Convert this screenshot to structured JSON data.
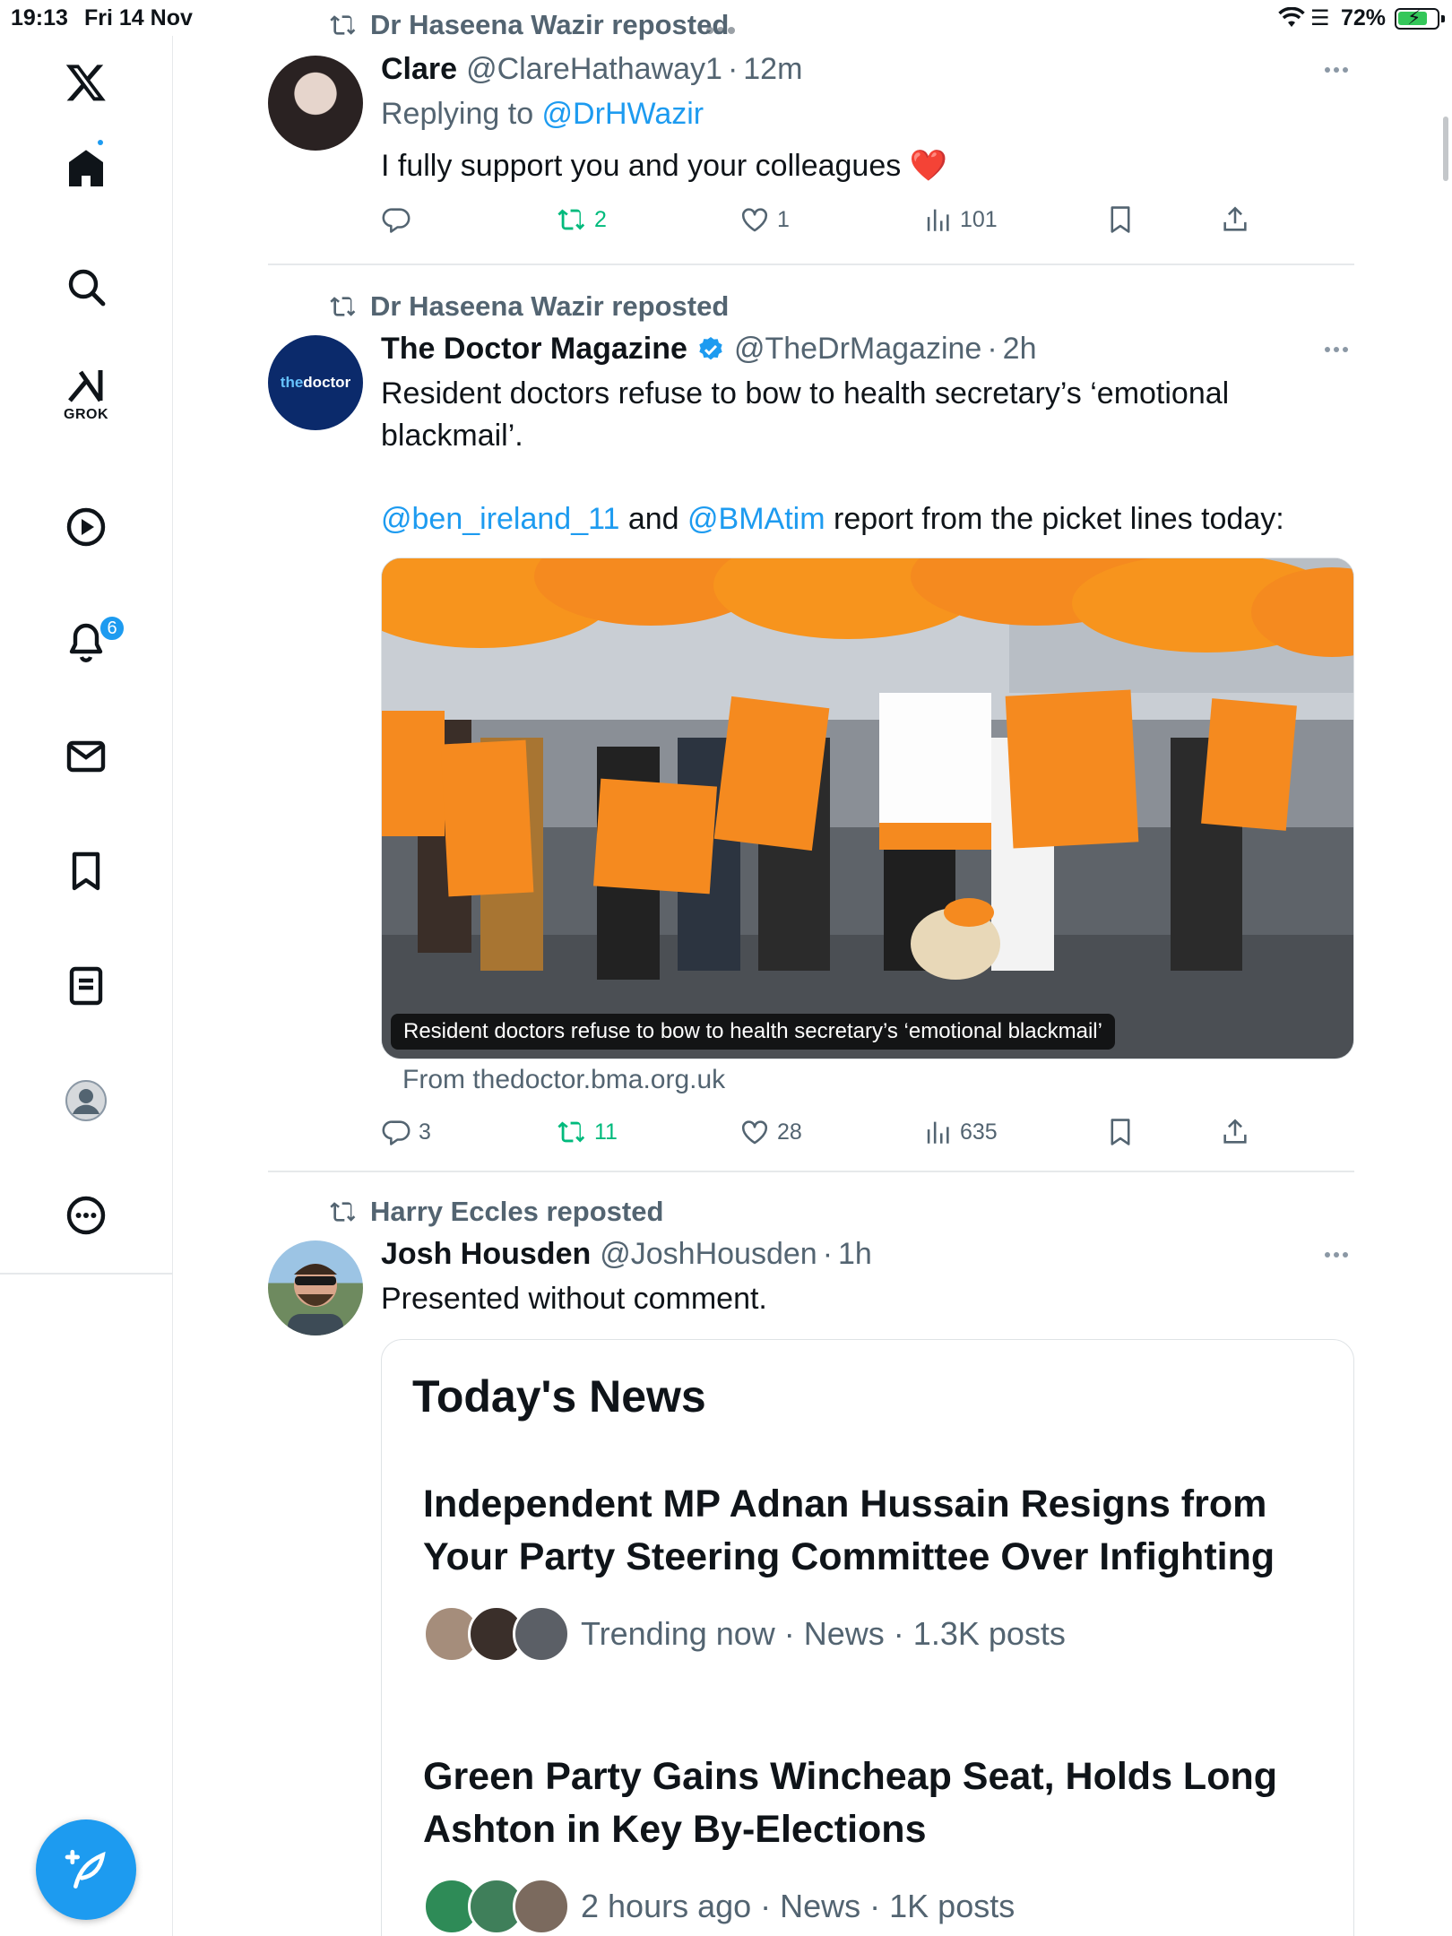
{
  "status_bar": {
    "time": "19:13",
    "date": "Fri 14 Nov",
    "battery": "72%"
  },
  "sidebar": {
    "items": [
      {
        "icon": "x-logo-icon"
      },
      {
        "icon": "home-icon"
      },
      {
        "icon": "search-icon"
      },
      {
        "icon": "grok-icon",
        "label": "GROK"
      },
      {
        "icon": "video-play-icon"
      },
      {
        "icon": "notifications-bell-icon",
        "badge": "6"
      },
      {
        "icon": "messages-envelope-icon"
      },
      {
        "icon": "bookmarks-icon"
      },
      {
        "icon": "lists-icon"
      },
      {
        "icon": "profile-avatar-icon"
      },
      {
        "icon": "more-circle-icon"
      }
    ],
    "compose_icon": "compose-post-icon",
    "accent": "#1d9bf0"
  },
  "posts": [
    {
      "reposted_by": "Dr Haseena Wazir reposted",
      "name": "Clare",
      "handle": "@ClareHathaway1",
      "time": "12m",
      "replying_prefix": "Replying to ",
      "replying_to": "@DrHWazir",
      "text": "I fully support you and your colleagues",
      "emoji": "❤️",
      "replies": "",
      "reposts": "2",
      "likes": "1",
      "views": "101"
    },
    {
      "reposted_by": "Dr Haseena Wazir reposted",
      "name": "The Doctor Magazine",
      "handle": "@TheDrMagazine",
      "time": "2h",
      "avatar_text_a": "the",
      "avatar_text_b": "doctor",
      "text_line1": "Resident doctors refuse to bow to health secretary’s ‘emotional blackmail’.",
      "mention1": "@ben_ireland_11",
      "and_text": " and ",
      "mention2": "@BMAtim",
      "text_line2_rest": " report from the picket lines today:",
      "media_caption": "Resident doctors refuse to bow to health secretary’s ‘emotional blackmail’",
      "link_from": "From thedoctor.bma.org.uk",
      "replies": "3",
      "reposts": "11",
      "likes": "28",
      "views": "635"
    },
    {
      "reposted_by": "Harry Eccles reposted",
      "name": "Josh Housden",
      "handle": "@JoshHousden",
      "time": "1h",
      "text": "Presented without comment.",
      "card": {
        "title": "Today's News",
        "items": [
          {
            "headline": "Independent MP Adnan Hussain Resigns from Your Party Steering Committee Over Infighting",
            "meta": "Trending now · News · 1.3K posts"
          },
          {
            "headline": "Green Party Gains Wincheap Seat, Holds Long Ashton in Key By-Elections",
            "meta": "2 hours ago · News · 1K posts"
          }
        ]
      }
    }
  ]
}
